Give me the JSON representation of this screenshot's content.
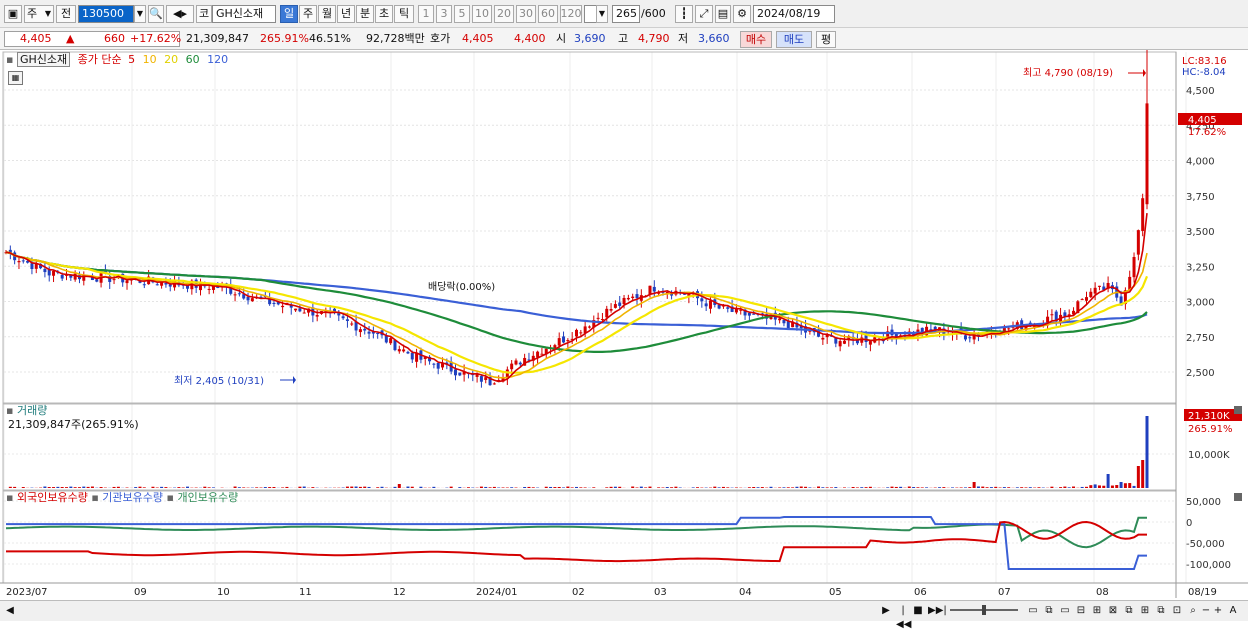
{
  "toolbar": {
    "period_week": "주",
    "prev": "전",
    "code": "130500",
    "type_prefix": "코",
    "stock_name": "GH신소재",
    "tabs": [
      "일",
      "주",
      "월",
      "년",
      "분",
      "초",
      "틱"
    ],
    "intervals": [
      "1",
      "3",
      "5",
      "10",
      "20",
      "30",
      "60",
      "120"
    ],
    "count": "265",
    "count_total": "/600",
    "date": "2024/08/19"
  },
  "quote": {
    "price": "4,405",
    "arrow": "▲",
    "change": "660",
    "change_pct": "+17.62%",
    "volume": "21,309,847",
    "volume_pct": "265.91%",
    "turnover": "46.51%",
    "amount": "92,728백만",
    "ask_label": "호가",
    "ask1": "4,405",
    "ask2": "4,400",
    "open_label": "시",
    "open": "3,690",
    "high_label": "고",
    "high": "4,790",
    "low_label": "저",
    "low": "3,660",
    "buy": "매수",
    "sell": "매도",
    "flat": "평"
  },
  "price_panel": {
    "legend_name": "GH신소재",
    "legend_title": "종가 단순",
    "ma_periods": [
      "5",
      "10",
      "20",
      "60",
      "120"
    ],
    "lc_label": "LC:83.16",
    "hc_label": "HC:-8.04",
    "high_note": "최고 4,790 (08/19)",
    "low_note": "최저 2,405 (10/31)",
    "div_note": "배당락(0.00%)",
    "last_price": "4,405",
    "last_pct": "17.62%",
    "y_ticks": [
      "4,500",
      "4,250",
      "4,000",
      "3,750",
      "3,500",
      "3,250",
      "3,000",
      "2,750",
      "2,500"
    ]
  },
  "volume_panel": {
    "title": "거래량",
    "value": "21,309,847주(265.91%)",
    "last_label": "21,310K",
    "last_pct": "265.91%",
    "tick": "10,000K"
  },
  "holding_panel": {
    "series": [
      "외국인보유수량",
      "기관보유수량",
      "개인보유수량"
    ],
    "y_ticks": [
      "50,000",
      "0",
      "-50,000",
      "-100,000"
    ]
  },
  "x_axis": [
    "2023/07",
    "09",
    "10",
    "11",
    "12",
    "2024/01",
    "02",
    "03",
    "04",
    "05",
    "06",
    "07",
    "08",
    "08/19"
  ],
  "colors": {
    "up": "#d40000",
    "down": "#1f3fbf",
    "ma5": "#d40000",
    "ma10": "#f0b400",
    "ma20": "#f5e600",
    "ma60": "#1e8c3a",
    "ma120": "#3a5fd6",
    "foreign": "#d40000",
    "institution": "#3a5fd6",
    "individual": "#2e8b57"
  }
}
